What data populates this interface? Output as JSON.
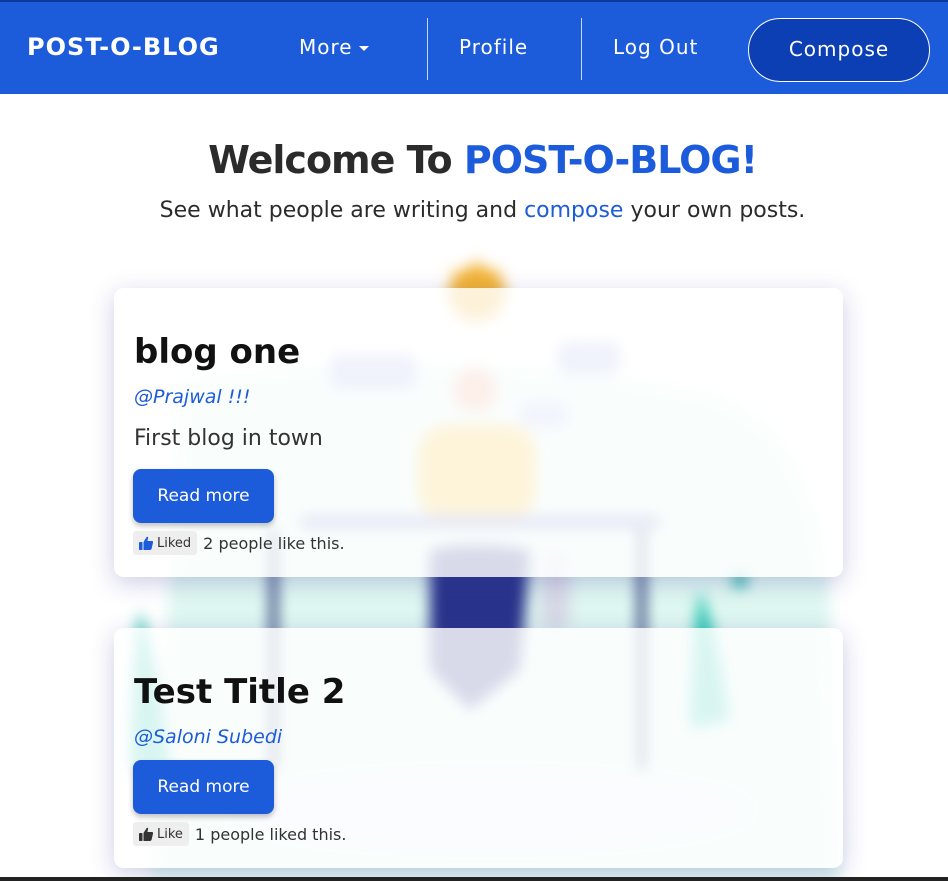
{
  "navbar": {
    "brand": "POST-O-BLOG",
    "more_label": "More",
    "profile_label": "Profile",
    "logout_label": "Log Out",
    "compose_label": "Compose"
  },
  "header": {
    "welcome_prefix": "Welcome To",
    "welcome_brand": "POST-O-BLOG!",
    "subtitle_before": "See what people are writing and",
    "subtitle_link": "compose",
    "subtitle_after": "your own posts."
  },
  "posts": [
    {
      "title": "blog one",
      "author": "@Prajwal !!!",
      "excerpt": "First blog in town",
      "read_more": "Read more",
      "like_label": "Liked",
      "like_text": "2 people like this."
    },
    {
      "title": "Test Title 2",
      "author": "@Saloni Subedi",
      "read_more": "Read more",
      "like_label": "Like",
      "like_text": "1 people liked this."
    }
  ],
  "colors": {
    "primary": "#1c5bd9",
    "navbar_border": "#0d3a9a",
    "compose_button": "#0b3fb3",
    "text": "#2b2b2b"
  },
  "icons": {
    "caret": "chevron-down-icon",
    "like": "thumbs-up-icon"
  }
}
